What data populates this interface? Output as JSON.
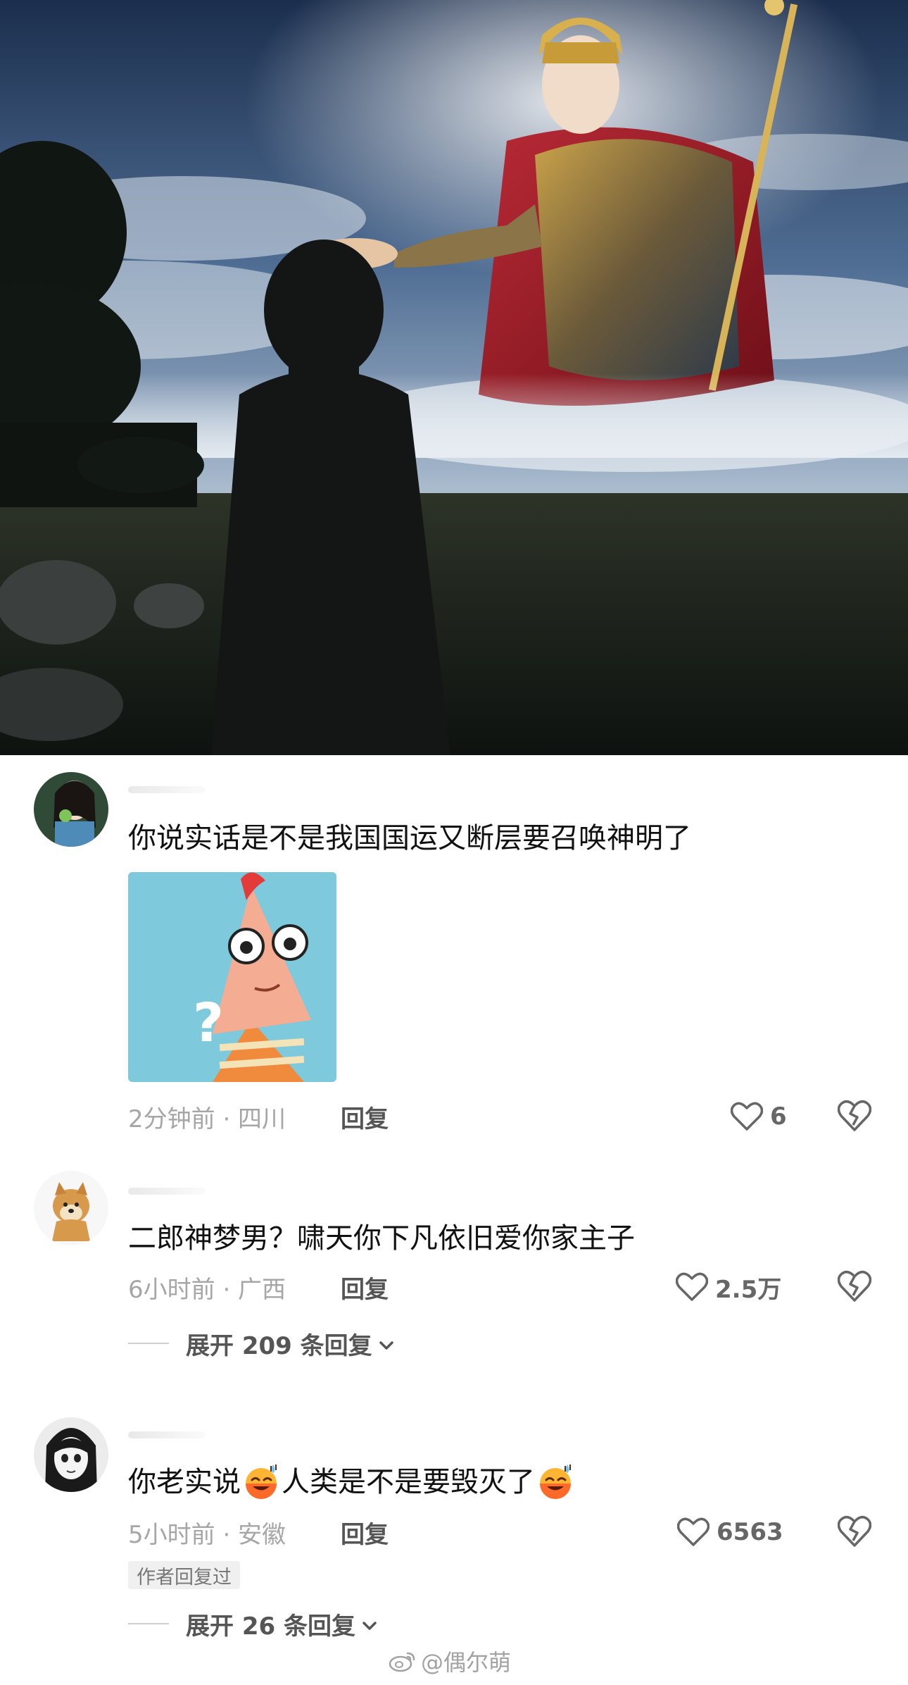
{
  "comments": [
    {
      "text": "你说实话是不是我国国运又断层要召唤神明了",
      "time_location": "2分钟前 · 四川",
      "reply_label": "回复",
      "likes": "6",
      "sticker_text": "?"
    },
    {
      "text": "二郎神梦男？啸天你下凡依旧爱你家主子",
      "time_location": "6小时前 · 广西",
      "reply_label": "回复",
      "likes": "2.5万",
      "expand_label": "展开 209 条回复"
    },
    {
      "text_part1": "你老实说",
      "text_part2": "人类是不是要毁灭了",
      "time_location": "5小时前 · 安徽",
      "reply_label": "回复",
      "likes": "6563",
      "author_badge": "作者回复过",
      "expand_label": "展开 26 条回复"
    }
  ],
  "watermark": "@偶尔萌",
  "colors": {
    "meta_gray": "#a6a6a6",
    "text": "#111111",
    "badge_bg": "#f0f0f0"
  },
  "icons": [
    "heart-icon",
    "broken-heart-icon",
    "chevron-down-icon",
    "weibo-icon",
    "sweat-smile-emoji"
  ]
}
